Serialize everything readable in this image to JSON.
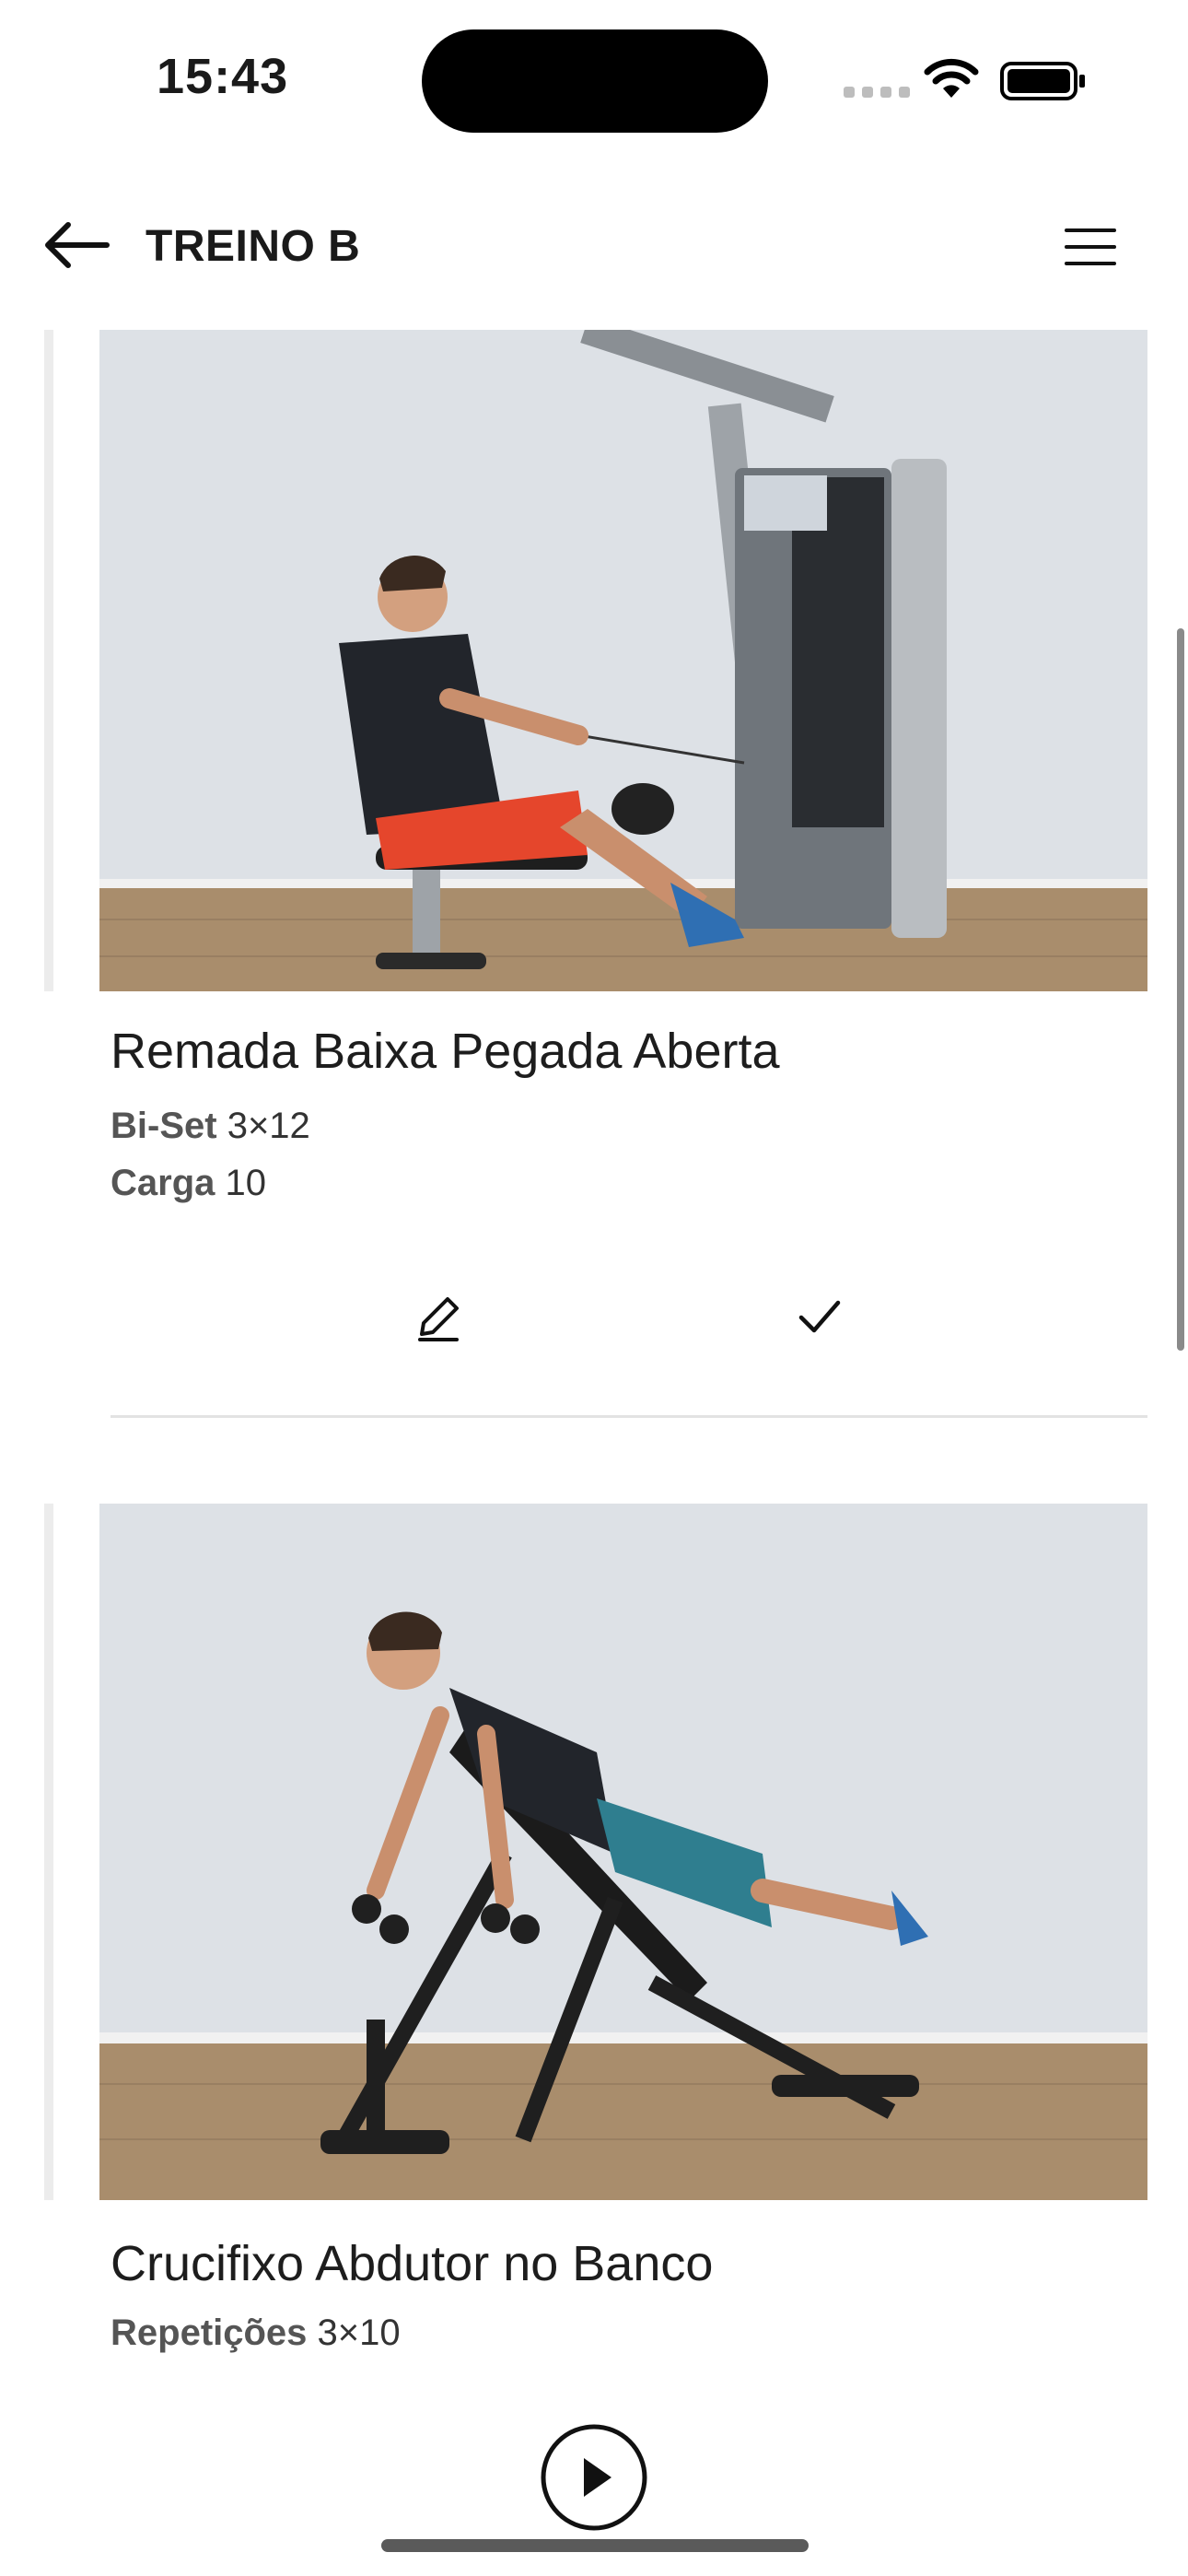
{
  "status_bar": {
    "time": "15:43"
  },
  "header": {
    "title": "TREINO B"
  },
  "exercises": [
    {
      "name": "Remada Baixa Pegada Aberta",
      "meta": [
        {
          "label": "Bi-Set",
          "value": "3×12"
        },
        {
          "label": "Carga",
          "value": "10"
        }
      ]
    },
    {
      "name": "Crucifixo Abdutor no Banco",
      "meta": [
        {
          "label": "Repetições",
          "value": "3×10"
        }
      ]
    }
  ],
  "colors": {
    "accent_bar": "#ececec",
    "wall": "#dde1e6",
    "floor": "#a98d6c"
  }
}
